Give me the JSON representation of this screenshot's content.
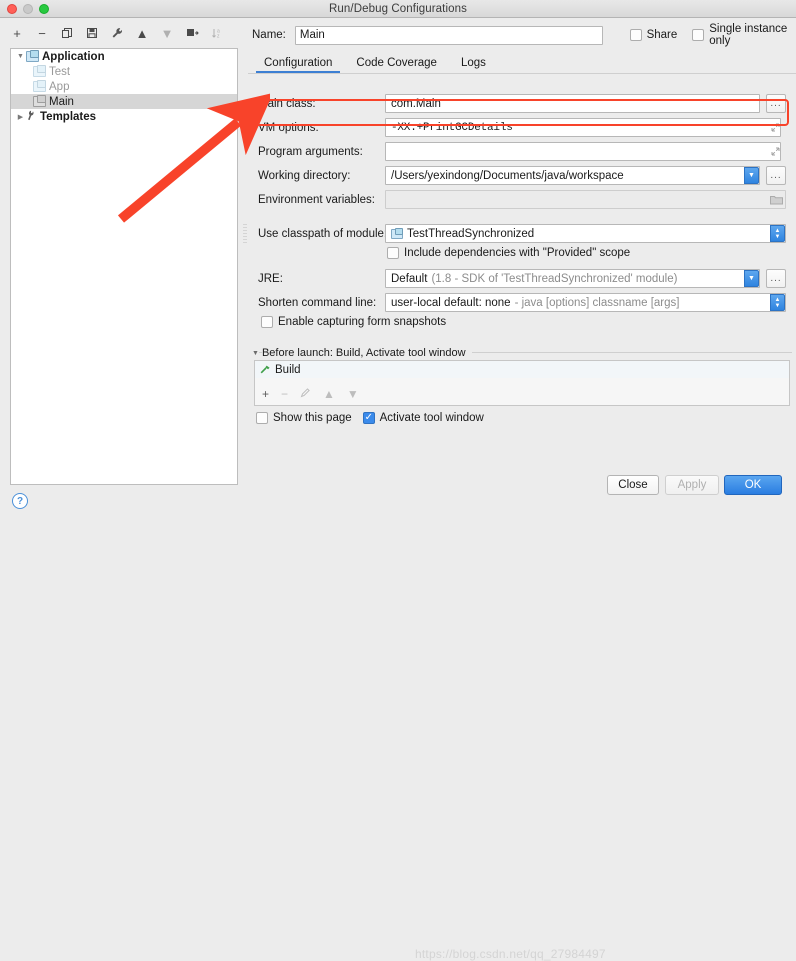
{
  "window": {
    "title": "Run/Debug Configurations",
    "traffic_lights": [
      "close-red",
      "minimize-gray",
      "zoom-green"
    ]
  },
  "sidebar": {
    "toolbar": [
      {
        "name": "add",
        "glyph": "+",
        "enabled": true
      },
      {
        "name": "remove",
        "glyph": "−",
        "enabled": true
      },
      {
        "name": "copy",
        "glyph": "❐",
        "enabled": true
      },
      {
        "name": "save",
        "glyph": "▣",
        "enabled": true
      },
      {
        "name": "edit-templates",
        "glyph": "ᴿ",
        "enabled": true
      },
      {
        "name": "move-up",
        "glyph": "▲",
        "enabled": true
      },
      {
        "name": "move-down",
        "glyph": "▼",
        "enabled": false
      },
      {
        "name": "move-into-folder",
        "glyph": "▬",
        "enabled": true
      },
      {
        "name": "sort-alphabetically",
        "glyph": "⇅",
        "enabled": false
      }
    ],
    "tree": [
      {
        "label": "Application",
        "level": 0,
        "expanded": true,
        "bold": true,
        "icon": "application-folder-icon",
        "selected": false,
        "faded": false
      },
      {
        "label": "Test",
        "level": 1,
        "expanded": null,
        "bold": false,
        "icon": "run-config-icon",
        "selected": false,
        "faded": true
      },
      {
        "label": "App",
        "level": 1,
        "expanded": null,
        "bold": false,
        "icon": "run-config-icon",
        "selected": false,
        "faded": true
      },
      {
        "label": "Main",
        "level": 1,
        "expanded": null,
        "bold": false,
        "icon": "run-config-icon",
        "selected": true,
        "faded": false
      },
      {
        "label": "Templates",
        "level": 0,
        "expanded": false,
        "bold": true,
        "icon": "wrench-icon",
        "selected": false,
        "faded": false
      }
    ],
    "help_button": "?"
  },
  "header": {
    "name_label": "Name:",
    "name_value": "Main",
    "name_placeholder": "",
    "share_label": "Share",
    "share_checked": false,
    "single_instance_label": "Single instance only",
    "single_instance_checked": false
  },
  "tabs": [
    {
      "label": "Configuration",
      "active": true
    },
    {
      "label": "Code Coverage",
      "active": false
    },
    {
      "label": "Logs",
      "active": false
    }
  ],
  "configuration": {
    "main_class": {
      "label": "Main class:",
      "value": "com.Main",
      "browse": "..."
    },
    "vm_options": {
      "label": "VM options:",
      "value": "-XX:+PrintGCDetails",
      "highlighted": true
    },
    "program_arguments": {
      "label": "Program arguments:",
      "value": "",
      "placeholder": ""
    },
    "working_directory": {
      "label": "Working directory:",
      "value": "/Users/yexindong/Documents/java/workspace",
      "browse": "..."
    },
    "environment_variables": {
      "label": "Environment variables:",
      "value": "",
      "disabled": true
    },
    "classpath_module": {
      "label": "Use classpath of module:",
      "value": "TestThreadSynchronized"
    },
    "include_provided": {
      "label": "Include dependencies with \"Provided\" scope",
      "checked": false
    },
    "jre": {
      "label": "JRE:",
      "value": "Default",
      "hint": "(1.8 - SDK of 'TestThreadSynchronized' module)",
      "browse": "..."
    },
    "shorten_command_line": {
      "label": "Shorten command line:",
      "value": "user-local default: none",
      "hint": "- java [options] classname [args]"
    },
    "enable_capturing": {
      "label": "Enable capturing form snapshots",
      "checked": false
    }
  },
  "before_launch": {
    "header": "Before launch: Build, Activate tool window",
    "items": [
      {
        "label": "Build",
        "icon": "hammer-icon"
      }
    ],
    "toolbar": [
      {
        "name": "add",
        "glyph": "+",
        "enabled": true
      },
      {
        "name": "remove",
        "glyph": "−",
        "enabled": false
      },
      {
        "name": "edit",
        "glyph": "✎",
        "enabled": false
      },
      {
        "name": "move-up",
        "glyph": "▲",
        "enabled": false
      },
      {
        "name": "move-down",
        "glyph": "▼",
        "enabled": false
      }
    ],
    "show_this_page": {
      "label": "Show this page",
      "checked": false
    },
    "activate_tool_window": {
      "label": "Activate tool window",
      "checked": true
    }
  },
  "footer": {
    "close": "Close",
    "apply": "Apply",
    "apply_enabled": false,
    "ok": "OK",
    "watermark": "https://blog.csdn.net/qq_27984497"
  },
  "annotation": {
    "arrow_color": "#f8432a",
    "highlight_color": "#f8432a",
    "target": "vm-options-row"
  }
}
